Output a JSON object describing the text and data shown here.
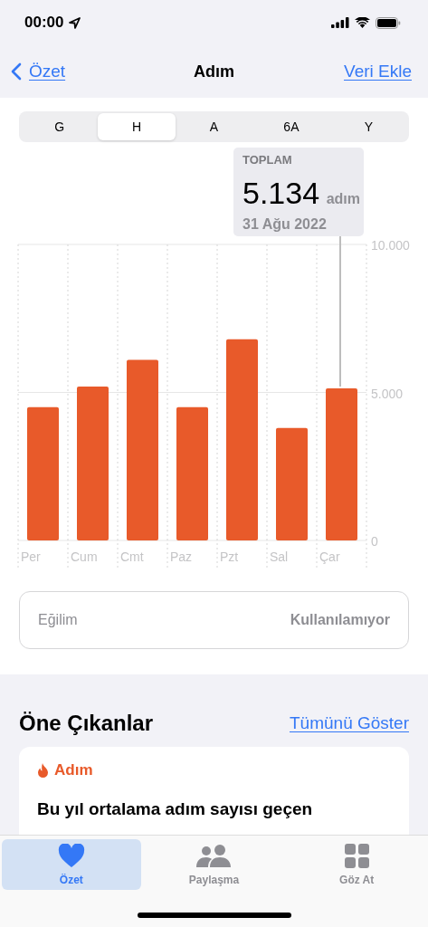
{
  "status_bar": {
    "time": "00:00"
  },
  "nav": {
    "back": "Özet",
    "title": "Adım",
    "action": "Veri Ekle"
  },
  "segments": [
    {
      "label": "G",
      "selected": false
    },
    {
      "label": "H",
      "selected": true
    },
    {
      "label": "A",
      "selected": false
    },
    {
      "label": "6A",
      "selected": false
    },
    {
      "label": "Y",
      "selected": false
    }
  ],
  "summary": {
    "label": "TOPLAM",
    "value": "5.134",
    "unit": "adım",
    "date": "31 Ağu 2022"
  },
  "chart_data": {
    "type": "bar",
    "categories": [
      "Per",
      "Cum",
      "Cmt",
      "Paz",
      "Pzt",
      "Sal",
      "Çar"
    ],
    "series": [
      {
        "color": "#e85a2a",
        "values": [
          4500,
          5200,
          6100,
          4500,
          6800,
          3800,
          5134
        ]
      }
    ],
    "ylim": [
      0,
      10000
    ],
    "yticks": [
      {
        "value": 0,
        "label": "0"
      },
      {
        "value": 5000,
        "label": "5.000"
      },
      {
        "value": 10000,
        "label": "10.000"
      }
    ]
  },
  "trend": {
    "label": "Eğilim",
    "value": "Kullanılamıyor"
  },
  "highlights": {
    "title": "Öne Çıkanlar",
    "link": "Tümünü Göster",
    "card": {
      "category": "Adım",
      "text": "Bu yıl ortalama adım sayısı geçen"
    }
  },
  "tab_bar": [
    {
      "label": "Özet",
      "kind": "heart",
      "selected": true
    },
    {
      "label": "Paylaşma",
      "kind": "people",
      "selected": false
    },
    {
      "label": "Göz At",
      "kind": "grid",
      "selected": false
    }
  ]
}
